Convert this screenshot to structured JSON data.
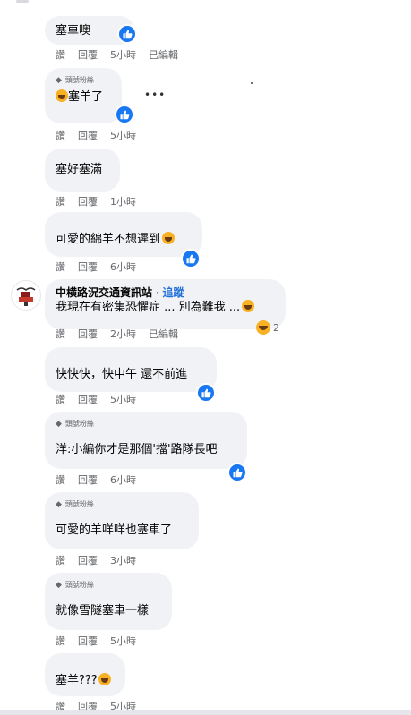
{
  "badge_label": "頭號粉絲",
  "actions": {
    "like": "讚",
    "reply": "回覆",
    "edited": "已編輯"
  },
  "comments": [
    {
      "text": "塞車噢",
      "time": "5小時",
      "edited": true
    },
    {
      "text": "塞羊了",
      "time": "5小時",
      "emoji": "haha"
    },
    {
      "text": "塞好塞滿",
      "time": "1小時"
    },
    {
      "text": "可愛的綿羊不想遲到",
      "time": "6小時",
      "emoji": "haha"
    },
    {
      "author": "中横路況交通資訊站",
      "follow": "追蹤",
      "text": "我現在有密集恐懼症 ... 別為難我 ...",
      "time": "2小時",
      "edited": true,
      "reaction_count": "2"
    },
    {
      "text": "快快快，快中午 還不前進",
      "time": "5小時"
    },
    {
      "text": "洋:小編你才是那個'擋'路隊長吧",
      "time": "6小時"
    },
    {
      "text": "可愛的羊咩咩也塞車了",
      "time": "3小時"
    },
    {
      "text": "就像雪隧塞車一樣",
      "time": "5小時"
    },
    {
      "text": "塞羊???",
      "time": "5小時",
      "emoji": "haha"
    }
  ],
  "colors": {
    "bubble": "#f0f2f5",
    "meta": "#65676b",
    "like": "#1877f2",
    "follow": "#216fdb",
    "haha": "#f7b125"
  },
  "icons": [
    "like-icon",
    "haha-icon",
    "diamond-icon",
    "more-icon"
  ]
}
